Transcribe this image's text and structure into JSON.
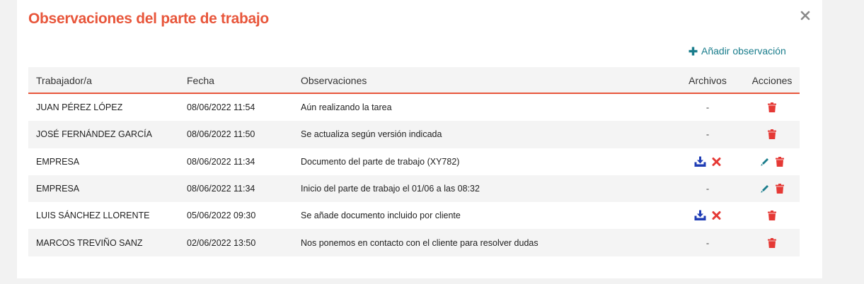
{
  "modal": {
    "title": "Observaciones del parte de trabajo",
    "close_icon": "close-icon",
    "add_label": "Añadir observación",
    "add_icon": "plus-icon"
  },
  "table": {
    "headers": {
      "worker": "Trabajador/a",
      "date": "Fecha",
      "observations": "Observaciones",
      "files": "Archivos",
      "actions": "Acciones"
    },
    "rows": [
      {
        "worker": "JUAN PÉREZ LÓPEZ",
        "date": "08/06/2022 11:54",
        "observation": "Aún realizando la tarea",
        "files": "-",
        "has_files": false,
        "can_edit": false
      },
      {
        "worker": "JOSÉ FERNÁNDEZ GARCÍA",
        "date": "08/06/2022 11:50",
        "observation": "Se actualiza según versión indicada",
        "files": "-",
        "has_files": false,
        "can_edit": false
      },
      {
        "worker": "EMPRESA",
        "date": "08/06/2022 11:34",
        "observation": "Documento del parte de trabajo (XY782)",
        "files": "",
        "has_files": true,
        "can_edit": true
      },
      {
        "worker": "EMPRESA",
        "date": "08/06/2022 11:34",
        "observation": "Inicio del parte de trabajo el 01/06 a las 08:32",
        "files": "-",
        "has_files": false,
        "can_edit": true
      },
      {
        "worker": "LUIS SÁNCHEZ LLORENTE",
        "date": "05/06/2022 09:30",
        "observation": "Se añade documento incluido por cliente",
        "files": "",
        "has_files": true,
        "can_edit": false
      },
      {
        "worker": "MARCOS TREVIÑO SANZ",
        "date": "02/06/2022 13:50",
        "observation": "Nos ponemos en contacto con el cliente para resolver dudas",
        "files": "-",
        "has_files": false,
        "can_edit": false
      }
    ]
  },
  "icons": {
    "download": "download-icon",
    "remove_file": "remove-file-icon",
    "edit": "pencil-icon",
    "delete": "trash-icon"
  },
  "colors": {
    "accent": "#e8563b",
    "link": "#1a7d8c",
    "download": "#1f3db5",
    "remove": "#e53935",
    "edit": "#1a7d8c",
    "delete": "#e53935",
    "row_alt": "#f4f4f4"
  }
}
